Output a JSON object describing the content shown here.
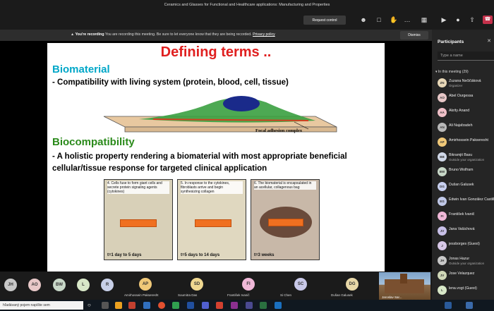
{
  "window_title": "Ceramics and Glasses for Functional and Healthcare applications: Manufacturing and Properties",
  "toolbar": {
    "request_control": "Request control"
  },
  "banner": {
    "recording_label": "You're recording",
    "message": "You are recording this meeting. Be sure to let everyone know that they are being recorded.",
    "privacy_link": "Privacy policy",
    "dismiss": "Dismiss"
  },
  "slide": {
    "title": "Defining terms ..",
    "heading1": "Biomaterial",
    "text1": "-  Compatibility with living system (protein, blood, cell, tissue)",
    "figure_caption": "Focal adhesion complex",
    "heading2": "Biocompatibility",
    "text2": "-   A holistic property rendering a biomaterial with most appropriate beneficial cellular/tissue response for targeted clinical application",
    "panels": [
      {
        "text": "4. Cells fuse to form giant cells and secrete protein signaling agents (cytokines)",
        "day": "t=1 day to 5 days"
      },
      {
        "text": "5. In response to the cytokines, fibroblasts arrive and begin synthesizing collagen",
        "day": "t=5 days to 14 days"
      },
      {
        "text": "6. The biomaterial is encapsulated in an acellular, collagenous bag",
        "day": "t=3 weeks"
      }
    ]
  },
  "gallery": [
    {
      "initials": "JH",
      "color": "#c8c8c8"
    },
    {
      "initials": "AO",
      "color": "#e8c8c8"
    },
    {
      "initials": "BW",
      "color": "#c8d8c8"
    },
    {
      "initials": "L",
      "color": "#d8e8c8"
    },
    {
      "initials": "R",
      "color": "#c8d0e8"
    }
  ],
  "tiles": [
    {
      "initials": "AP",
      "name": "Amirhossein Pakseresht",
      "color": "#f0c878"
    },
    {
      "initials": "SD",
      "name": "Soumitra Das",
      "color": "#f0d890"
    },
    {
      "initials": "FI",
      "name": "František Ivanič",
      "color": "#f0b8d8"
    },
    {
      "initials": "SC",
      "name": "Si Chen",
      "color": "#c8c8e8"
    },
    {
      "initials": "DG",
      "name": "Dušan Galusek",
      "color": "#e8d8a8"
    }
  ],
  "camera_tile": {
    "name": "Jaroslav Sar..."
  },
  "participants": {
    "title": "Participants",
    "search_placeholder": "Type a name",
    "group_label": "In this meeting (29)",
    "list": [
      {
        "initials": "ZN",
        "name": "Zuzana Nečičáková",
        "sub": "Organizer",
        "color": "#e8d8b8"
      },
      {
        "initials": "AO",
        "name": "Abel Ourgessa",
        "sub": "",
        "color": "#e8c8c8"
      },
      {
        "initials": "AA",
        "name": "Akrity Anand",
        "sub": "",
        "color": "#f0c0c8"
      },
      {
        "initials": "AN",
        "name": "Ali Najafzadeh",
        "sub": "",
        "color": "#b8b8b8"
      },
      {
        "initials": "AP",
        "name": "Amirhossein Pakseresht",
        "sub": "",
        "color": "#f0c878"
      },
      {
        "initials": "BB",
        "name": "Bikramjit Basu",
        "sub": "Outside your organization",
        "color": "#d0d8e8"
      },
      {
        "initials": "BW",
        "name": "Bruno Wolfram",
        "sub": "",
        "color": "#c8d8c8"
      },
      {
        "initials": "DG",
        "name": "Dušan Galusek",
        "sub": "",
        "color": "#c8d0f0"
      },
      {
        "initials": "EG",
        "name": "Edwin Ivan González Castillo",
        "sub": "",
        "color": "#c0c8e8"
      },
      {
        "initials": "FI",
        "name": "František Ivanič",
        "sub": "",
        "color": "#f0b8d8"
      },
      {
        "initials": "JV",
        "name": "Jana Valúchová",
        "sub": "",
        "color": "#c8c0e8"
      },
      {
        "initials": "J",
        "name": "jessborges (Guest)",
        "sub": "",
        "color": "#d8c8e8"
      },
      {
        "initials": "JH",
        "name": "Jonas Hazur",
        "sub": "Outside your organization",
        "color": "#c8c8c8"
      },
      {
        "initials": "JV",
        "name": "Jose Velazquez",
        "sub": "",
        "color": "#d0d8b8"
      },
      {
        "initials": "L",
        "name": "lena.vogt (Guest)",
        "sub": "",
        "color": "#d8e8c8"
      }
    ]
  },
  "taskbar": {
    "search_placeholder": "hľadávaný pojem napíšte sem"
  }
}
